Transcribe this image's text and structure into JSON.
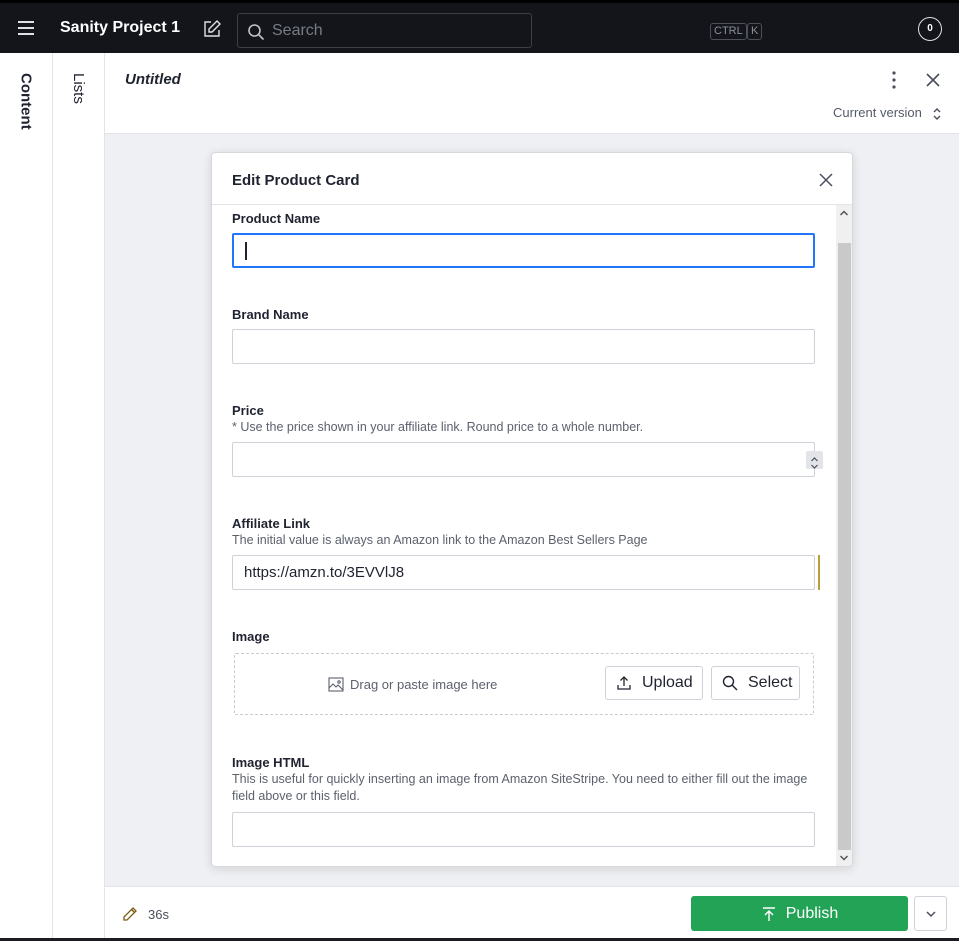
{
  "topbar": {
    "project_title": "Sanity Project 1",
    "search_placeholder": "Search",
    "shortcut_ctrl": "CTRL",
    "shortcut_k": "K",
    "notification_count": "0"
  },
  "panes": {
    "content_label": "Content",
    "lists_label": "Lists"
  },
  "document": {
    "title": "Untitled",
    "version_label": "Current version"
  },
  "dialog": {
    "title": "Edit Product Card",
    "fields": {
      "product_name": {
        "label": "Product Name",
        "value": ""
      },
      "brand_name": {
        "label": "Brand Name",
        "value": ""
      },
      "price": {
        "label": "Price",
        "description": "* Use the price shown in your affiliate link. Round price to a whole number.",
        "value": ""
      },
      "affiliate_link": {
        "label": "Affiliate Link",
        "description": "The initial value is always an Amazon link to the Amazon Best Sellers Page",
        "value": "https://amzn.to/3EVVlJ8"
      },
      "image": {
        "label": "Image",
        "drop_text": "Drag or paste image here",
        "upload_label": "Upload",
        "select_label": "Select"
      },
      "image_html": {
        "label": "Image HTML",
        "description": "This is useful for quickly inserting an image from Amazon SiteStripe. You need to either fill out the image field above or this field.",
        "value": ""
      }
    }
  },
  "footer": {
    "edited_ago": "36s",
    "publish_label": "Publish"
  },
  "colors": {
    "topbar_bg": "#13151b",
    "focus_blue": "#2276fc",
    "publish_green": "#22a356",
    "change_indicator": "#b8a13a"
  }
}
